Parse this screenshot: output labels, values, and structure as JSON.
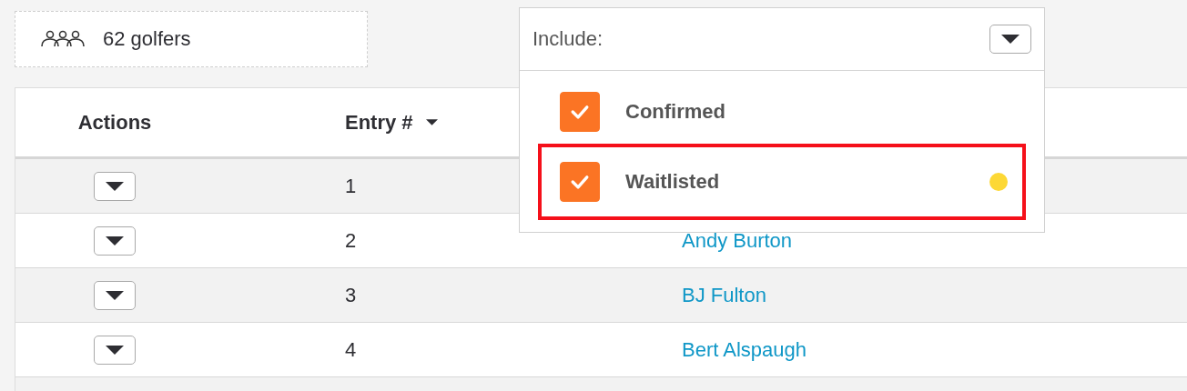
{
  "summary": {
    "count_text": "62 golfers"
  },
  "table": {
    "columns": [
      {
        "label": "Actions",
        "sorted": false
      },
      {
        "label": "Entry #",
        "sorted": true
      }
    ],
    "rows": [
      {
        "entry": "1"
      },
      {
        "entry": "2",
        "name": "Andy Burton"
      },
      {
        "entry": "3",
        "name": "BJ Fulton"
      },
      {
        "entry": "4",
        "name": "Bert Alspaugh"
      }
    ]
  },
  "include_filter": {
    "label": "Include:",
    "options": [
      {
        "label": "Confirmed",
        "checked": true,
        "highlighted": false
      },
      {
        "label": "Waitlisted",
        "checked": true,
        "highlighted": true,
        "color": "#fdd835"
      }
    ]
  }
}
